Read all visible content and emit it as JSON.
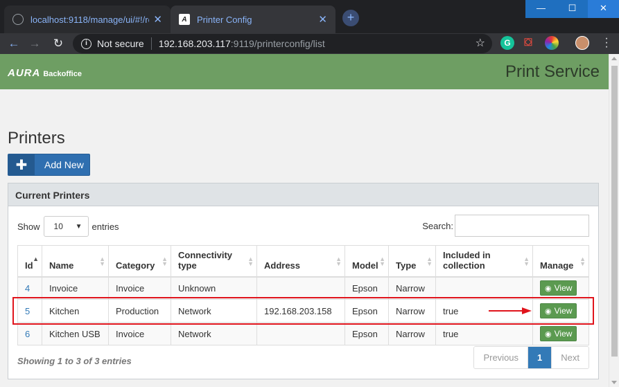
{
  "browser": {
    "tabs": [
      {
        "title": "localhost:9118/manage/ui/#!/roo",
        "favicon": "globe-icon"
      },
      {
        "title": "Printer Config",
        "favicon": "app-favicon"
      }
    ],
    "window_buttons": {
      "minimize": "—",
      "maximize": "☐",
      "close": "✕"
    },
    "address_bar": {
      "security": "Not secure",
      "host": "192.168.203.117",
      "rest": ":9119/printerconfig/list"
    },
    "extensions": [
      "grammarly-icon",
      "pdf-icon",
      "color-picker-icon",
      "profile-avatar"
    ]
  },
  "app": {
    "logo": "AURA",
    "logo_sub": "Backoffice",
    "title": "Print Service",
    "accent_color": "#6e9e63"
  },
  "page": {
    "heading": "Printers",
    "add_button": "Add New",
    "panel_title": "Current Printers",
    "length": {
      "show": "Show",
      "value": "10",
      "entries": "entries"
    },
    "search_label": "Search:",
    "columns": [
      "Id",
      "Name",
      "Category",
      "Connectivity type",
      "Address",
      "Model",
      "Type",
      "Included in collection",
      "Manage"
    ],
    "rows": [
      {
        "id": "4",
        "name": "Invoice",
        "category": "Invoice",
        "connectivity": "Unknown",
        "address": "",
        "model": "Epson",
        "type": "Narrow",
        "included": "",
        "action": "View"
      },
      {
        "id": "5",
        "name": "Kitchen",
        "category": "Production",
        "connectivity": "Network",
        "address": "192.168.203.158",
        "model": "Epson",
        "type": "Narrow",
        "included": "true",
        "action": "View"
      },
      {
        "id": "6",
        "name": "Kitchen USB",
        "category": "Invoice",
        "connectivity": "Network",
        "address": "",
        "model": "Epson",
        "type": "Narrow",
        "included": "true",
        "action": "View"
      }
    ],
    "info": "Showing 1 to 3 of 3 entries",
    "pager": {
      "prev": "Previous",
      "current": "1",
      "next": "Next"
    }
  }
}
